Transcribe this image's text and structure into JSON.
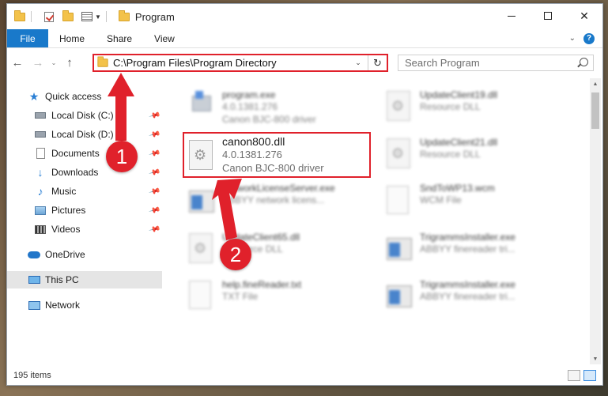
{
  "window": {
    "title": "Program"
  },
  "ribbon": {
    "tabs": [
      "File",
      "Home",
      "Share",
      "View"
    ],
    "help": "?"
  },
  "address": {
    "path": "C:\\Program Files\\Program Directory"
  },
  "search": {
    "placeholder": "Search Program"
  },
  "sidebar": {
    "items": [
      {
        "label": "Quick access",
        "icon": "star-icon"
      },
      {
        "label": "Local Disk (C:)",
        "icon": "drive-icon",
        "pinned": true
      },
      {
        "label": "Local Disk (D:)",
        "icon": "drive-icon",
        "pinned": true
      },
      {
        "label": "Documents",
        "icon": "document-icon",
        "pinned": true
      },
      {
        "label": "Downloads",
        "icon": "download-icon",
        "pinned": true
      },
      {
        "label": "Music",
        "icon": "music-icon",
        "pinned": true
      },
      {
        "label": "Pictures",
        "icon": "pictures-icon",
        "pinned": true
      },
      {
        "label": "Videos",
        "icon": "videos-icon",
        "pinned": true
      },
      {
        "label": "OneDrive",
        "icon": "cloud-icon"
      },
      {
        "label": "This PC",
        "icon": "computer-icon"
      },
      {
        "label": "Network",
        "icon": "network-icon"
      }
    ]
  },
  "files": {
    "left": [
      {
        "name": "program.exe",
        "line2": "4.0.1381.276",
        "line3": "Canon BJC-800 driver"
      },
      {
        "name": "canon800.dll",
        "line2": "4.0.1381.276",
        "line3": "Canon BJC-800 driver"
      },
      {
        "name": "NetworkLicenseServer.exe",
        "line2": "ABBYY network licens..."
      },
      {
        "name": "UpdateClient65.dll",
        "line2": "Resource DLL"
      },
      {
        "name": "help.fineReader.txt",
        "line2": "TXT File"
      }
    ],
    "right": [
      {
        "name": "UpdateClient19.dll",
        "line2": "Resource DLL"
      },
      {
        "name": "UpdateClient21.dll",
        "line2": "Resource DLL"
      },
      {
        "name": "SndToWP13.wcm",
        "line2": "WCM File"
      },
      {
        "name": "TrigrammsInstaller.exe",
        "line2": "ABBYY finereader tri..."
      },
      {
        "name": "TrigrammsInstaller.exe",
        "line2": "ABBYY finereader tri..."
      }
    ]
  },
  "status": {
    "count": "195 items"
  },
  "annotations": {
    "step1": "1",
    "step2": "2",
    "color": "#e0212b"
  }
}
